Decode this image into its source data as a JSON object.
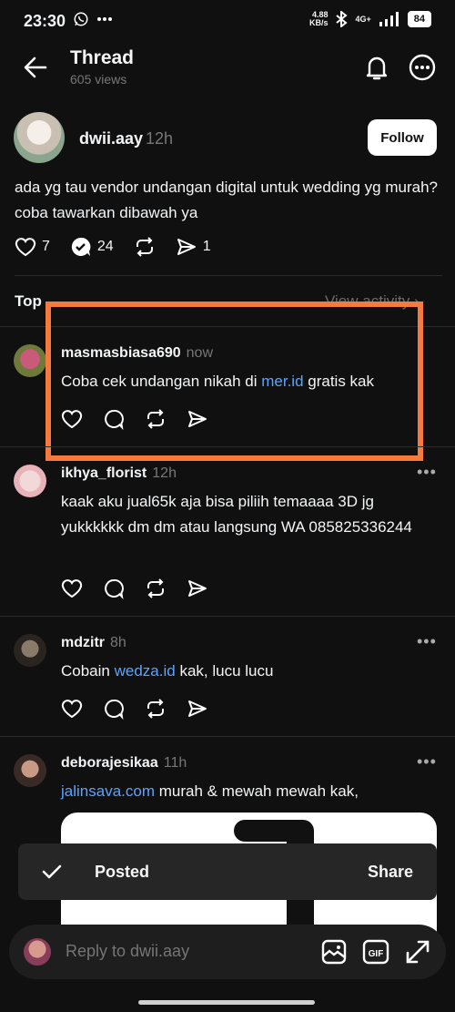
{
  "status_bar": {
    "time": "23:30",
    "net_speed_value": "4.88",
    "net_speed_unit": "KB/s",
    "network": "4G+",
    "battery": "84",
    "icons": [
      "whatsapp-icon",
      "more-dots-icon",
      "bluetooth-icon",
      "signal-icon",
      "battery-icon"
    ]
  },
  "header": {
    "title": "Thread",
    "views": "605 views"
  },
  "op": {
    "username": "dwii.aay",
    "time": "12h",
    "follow_label": "Follow",
    "text": "ada yg tau vendor undangan digital untuk wedding yg murah? coba tawarkan dibawah ya",
    "likes": "7",
    "replies": "24",
    "shares": "1"
  },
  "section": {
    "top_label": "Top",
    "activity_link": "View activity"
  },
  "replies": [
    {
      "username": "masmasbiasa690",
      "time": "now",
      "text_before": "Coba cek undangan nikah di ",
      "link": "mer.id",
      "text_after": " gratis kak"
    },
    {
      "username": "ikhya_florist",
      "time": "12h",
      "text": "kaak aku jual65k aja bisa piliih temaaaa 3D jg yukkkkkk dm dm atau langsung WA 085825336244"
    },
    {
      "username": "mdzitr",
      "time": "8h",
      "text_before": "Cobain ",
      "link": "wedza.id",
      "text_after": " kak, lucu lucu"
    },
    {
      "username": "deborajesikaa",
      "time": "11h",
      "link": "jalinsava.com",
      "text_after": " murah & mewah mewah kak,"
    }
  ],
  "toast": {
    "label": "Posted",
    "action": "Share"
  },
  "reply_bar": {
    "placeholder": "Reply to dwii.aay"
  },
  "colors": {
    "background": "#101010",
    "link": "#5aa3ff",
    "highlight": "#f47a3e"
  }
}
